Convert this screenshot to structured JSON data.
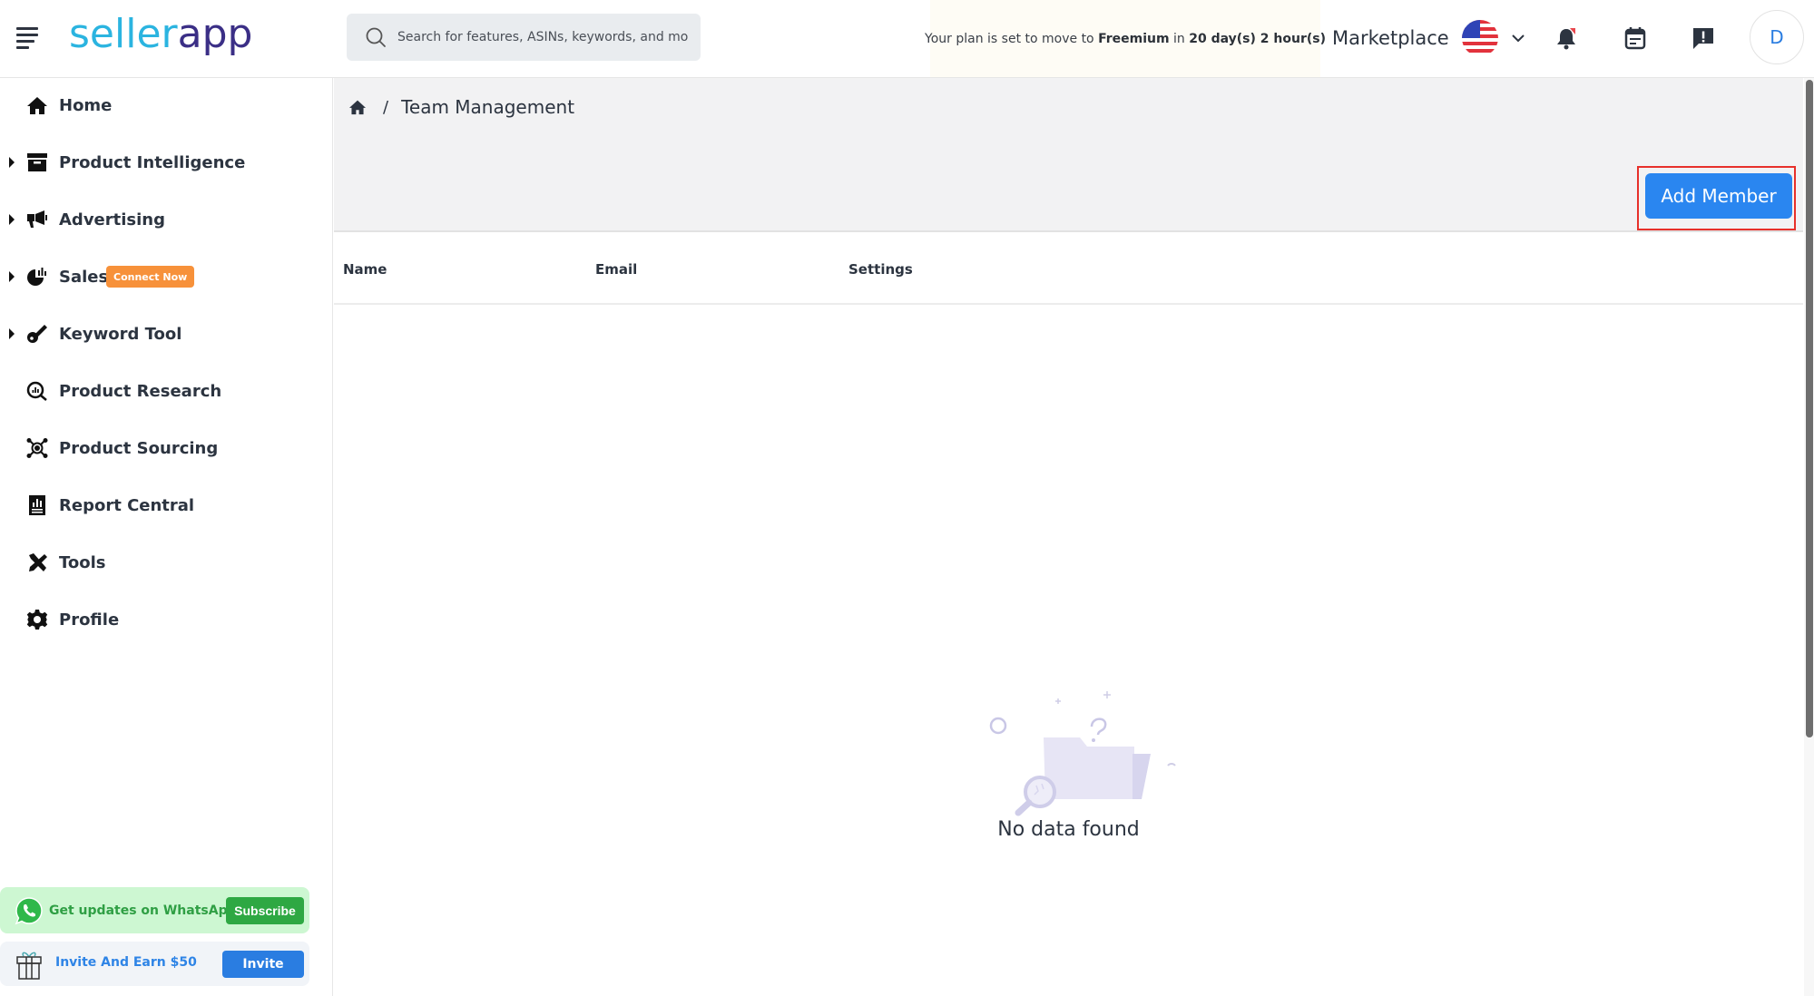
{
  "header": {
    "logo_part1": "seller",
    "logo_part2": "app",
    "search_placeholder": "Search for features, ASINs, keywords, and more",
    "plan_notice": {
      "prefix": "Your plan is set to move to ",
      "plan": "Freemium",
      "middle": " in ",
      "time": "20 day(s) 2 hour(s)"
    },
    "marketplace_label": "Marketplace",
    "marketplace_country": "US",
    "avatar_initial": "D"
  },
  "sidebar": {
    "items": [
      {
        "label": "Home",
        "icon": "home-icon",
        "expandable": false
      },
      {
        "label": "Product Intelligence",
        "icon": "archive-box-icon",
        "expandable": true
      },
      {
        "label": "Advertising",
        "icon": "megaphone-icon",
        "expandable": true
      },
      {
        "label": "Sales",
        "icon": "pie-chart-icon",
        "expandable": true,
        "badge": "Connect Now"
      },
      {
        "label": "Keyword Tool",
        "icon": "key-icon",
        "expandable": true
      },
      {
        "label": "Product Research",
        "icon": "magnify-chart-icon",
        "expandable": false
      },
      {
        "label": "Product Sourcing",
        "icon": "network-icon",
        "expandable": false
      },
      {
        "label": "Report Central",
        "icon": "report-icon",
        "expandable": false
      },
      {
        "label": "Tools",
        "icon": "tools-icon",
        "expandable": false
      },
      {
        "label": "Profile",
        "icon": "gear-icon",
        "expandable": false
      }
    ],
    "whatsapp": {
      "text": "Get updates on WhatsApp",
      "button": "Subscribe"
    },
    "invite": {
      "text": "Invite And Earn $50",
      "button": "Invite"
    }
  },
  "main": {
    "breadcrumb_current": "Team Management",
    "breadcrumb_separator": "/",
    "add_member_label": "Add Member",
    "table_headers": [
      "Name",
      "Email",
      "Settings"
    ],
    "empty_message": "No data found"
  },
  "colors": {
    "primary": "#2a86f0",
    "badge": "#f7913a",
    "whatsapp": "#2ea843",
    "highlight": "#e7302a"
  }
}
